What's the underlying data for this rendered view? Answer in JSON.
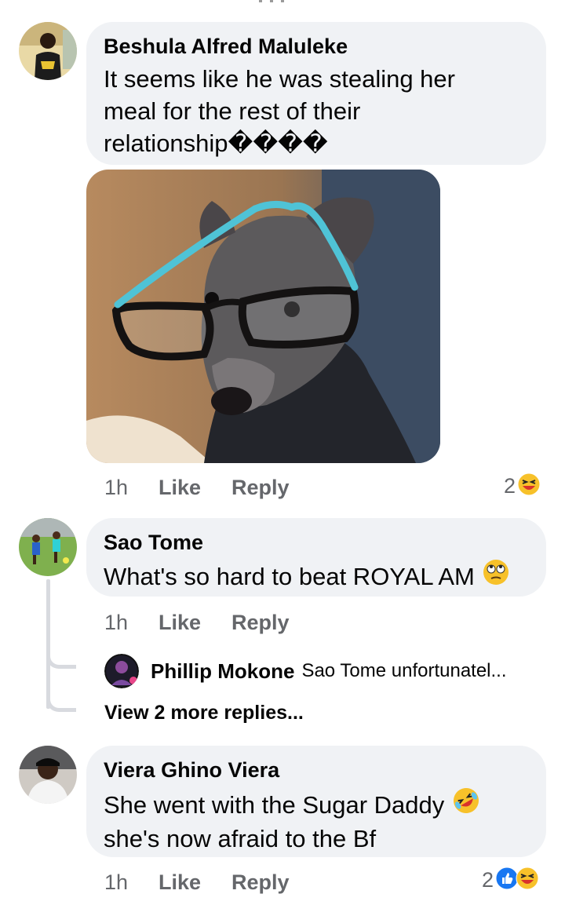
{
  "comments": [
    {
      "author": "Beshula Alfred Maluleke",
      "text_lines": [
        "It seems like he was stealing her",
        "meal for the rest of their",
        "relationship����"
      ],
      "time": "1h",
      "like": "Like",
      "reply": "Reply",
      "reaction_count": "2",
      "reactions": [
        "laughing-emoji"
      ]
    },
    {
      "author": "Sao Tome",
      "text": "What's so hard to beat ROYAL AM",
      "emoji": "eye-roll-emoji",
      "time": "1h",
      "like": "Like",
      "reply": "Reply",
      "reply_preview": {
        "author": "Phillip Mokone",
        "text": "Sao Tome unfortunatel..."
      },
      "view_more": "View 2 more replies..."
    },
    {
      "author": "Viera Ghino Viera",
      "text_lines": [
        "She went with the Sugar Daddy",
        "she's now afraid to the Bf"
      ],
      "emoji": "rolling-laughing-emoji",
      "time": "1h",
      "like": "Like",
      "reply": "Reply",
      "reaction_count": "2",
      "reactions": [
        "like-icon",
        "laughing-emoji"
      ]
    }
  ],
  "colors": {
    "bubble": "#f0f2f5",
    "secondary_text": "#65676b",
    "like_blue": "#1877f2",
    "emoji_yellow": "#f7c12a"
  }
}
